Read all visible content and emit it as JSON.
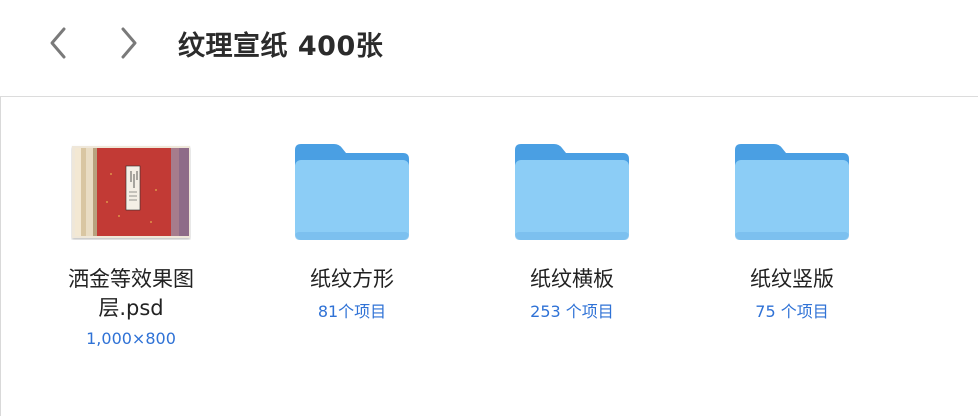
{
  "toolbar": {
    "title": "纹理宣纸 400张"
  },
  "items": [
    {
      "name_line1": "洒金等效果图",
      "name_line2": "层.psd",
      "meta": "1,000×800",
      "icon": "psd-thumbnail"
    },
    {
      "name": "纸纹方形",
      "meta": "81个项目",
      "icon": "folder-icon"
    },
    {
      "name": "纸纹横板",
      "meta": "253 个项目",
      "icon": "folder-icon"
    },
    {
      "name": "纸纹竖版",
      "meta": "75 个项目",
      "icon": "folder-icon"
    }
  ],
  "colors": {
    "accent": "#2f72d6",
    "folder_back": "#4a9fe3",
    "folder_front": "#8ccdf6",
    "psd_red": "#c23a35"
  }
}
